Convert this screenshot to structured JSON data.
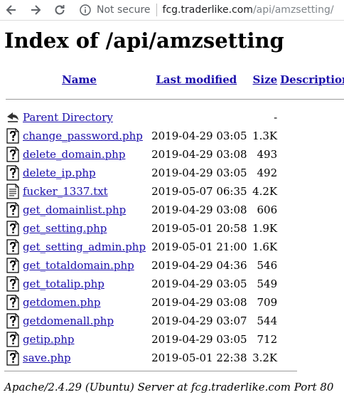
{
  "browser": {
    "security_text": "Not secure",
    "url_host": "fcg.traderlike.com",
    "url_path": "/api/amzsetting/"
  },
  "page": {
    "title": "Index of /api/amzsetting",
    "columns": {
      "name": "Name",
      "last_modified": "Last modified",
      "size": "Size",
      "description": "Description"
    },
    "parent": {
      "name": "Parent Directory",
      "size": "-"
    },
    "files": [
      {
        "name": "change_password.php",
        "modified": "2019-04-29 03:05",
        "size": "1.3K",
        "icon": "unknown-file-icon"
      },
      {
        "name": "delete_domain.php",
        "modified": "2019-04-29 03:08",
        "size": "493",
        "icon": "unknown-file-icon"
      },
      {
        "name": "delete_ip.php",
        "modified": "2019-04-29 03:05",
        "size": "492",
        "icon": "unknown-file-icon"
      },
      {
        "name": "fucker_1337.txt",
        "modified": "2019-05-07 06:35",
        "size": "4.2K",
        "icon": "text-file-icon"
      },
      {
        "name": "get_domainlist.php",
        "modified": "2019-04-29 03:08",
        "size": "606",
        "icon": "unknown-file-icon"
      },
      {
        "name": "get_setting.php",
        "modified": "2019-05-01 20:58",
        "size": "1.9K",
        "icon": "unknown-file-icon"
      },
      {
        "name": "get_setting_admin.php",
        "modified": "2019-05-01 21:00",
        "size": "1.6K",
        "icon": "unknown-file-icon"
      },
      {
        "name": "get_totaldomain.php",
        "modified": "2019-04-29 04:36",
        "size": "546",
        "icon": "unknown-file-icon"
      },
      {
        "name": "get_totalip.php",
        "modified": "2019-04-29 03:05",
        "size": "549",
        "icon": "unknown-file-icon"
      },
      {
        "name": "getdomen.php",
        "modified": "2019-04-29 03:08",
        "size": "709",
        "icon": "unknown-file-icon"
      },
      {
        "name": "getdomenall.php",
        "modified": "2019-04-29 03:07",
        "size": "544",
        "icon": "unknown-file-icon"
      },
      {
        "name": "getip.php",
        "modified": "2019-04-29 03:05",
        "size": "712",
        "icon": "unknown-file-icon"
      },
      {
        "name": "save.php",
        "modified": "2019-05-01 22:38",
        "size": "3.2K",
        "icon": "unknown-file-icon"
      }
    ],
    "footer": "Apache/2.4.29 (Ubuntu) Server at fcg.traderlike.com Port 80"
  },
  "colors": {
    "link": "#1a0dab",
    "rule": "#9a9a9a",
    "toolbar_text": "#5f6368"
  }
}
